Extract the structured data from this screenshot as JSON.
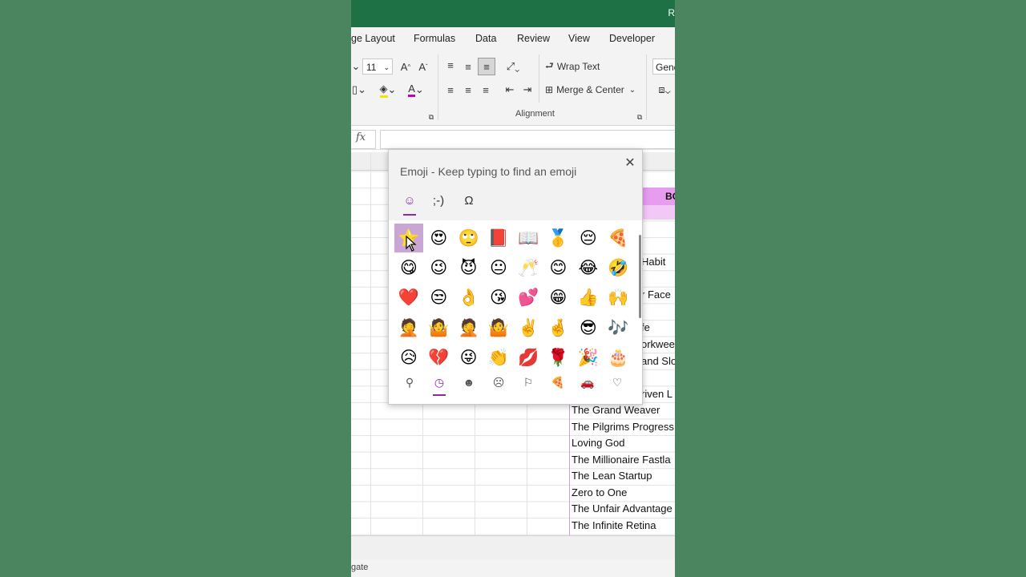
{
  "app": {
    "title_fragment": "R",
    "tabs": [
      "ge Layout",
      "Formulas",
      "Data",
      "Review",
      "View",
      "Developer"
    ],
    "font_size": "11",
    "number_format": "Gene",
    "wrap_text": "Wrap Text",
    "merge_center": "Merge & Center",
    "alignment_label": "Alignment",
    "formula_fx": "fx",
    "column_header_text": "BO",
    "status_text": "gate"
  },
  "cells": [
    "Habit",
    "r Face",
    "fe",
    "orkwee",
    "and Slo",
    "riven L",
    "The Grand Weaver",
    "The Pilgrims Progress",
    "Loving God",
    "The Millionaire Fastla",
    "The Lean Startup",
    "Zero to One",
    "The Unfair Advantage",
    "The Infinite Retina"
  ],
  "emoji_panel": {
    "title": "Emoji - Keep typing to find an emoji",
    "close_glyph": "✕",
    "tabs": [
      "☺",
      ";-)",
      "Ω"
    ],
    "emojis": [
      "⭐",
      "😍",
      "🙄",
      "📕",
      "📖",
      "🥇",
      "😔",
      "🍕",
      "😋",
      "😉",
      "😈",
      "😐",
      "🥂",
      "😊",
      "😂",
      "🤣",
      "❤️",
      "😒",
      "👌",
      "😘",
      "💕",
      "😁",
      "👍",
      "🙌",
      "🤦",
      "🤷",
      "🤦",
      "🤷",
      "✌️",
      "🤞",
      "😎",
      "🎶",
      "😥",
      "💔",
      "😜",
      "👏",
      "💋",
      "🌹",
      "🎉",
      "🎂"
    ],
    "categories": [
      "⚲",
      "◷",
      "☻",
      "☹",
      "⚐",
      "🍕",
      "🚗",
      "♡"
    ],
    "selected_index": 0
  }
}
